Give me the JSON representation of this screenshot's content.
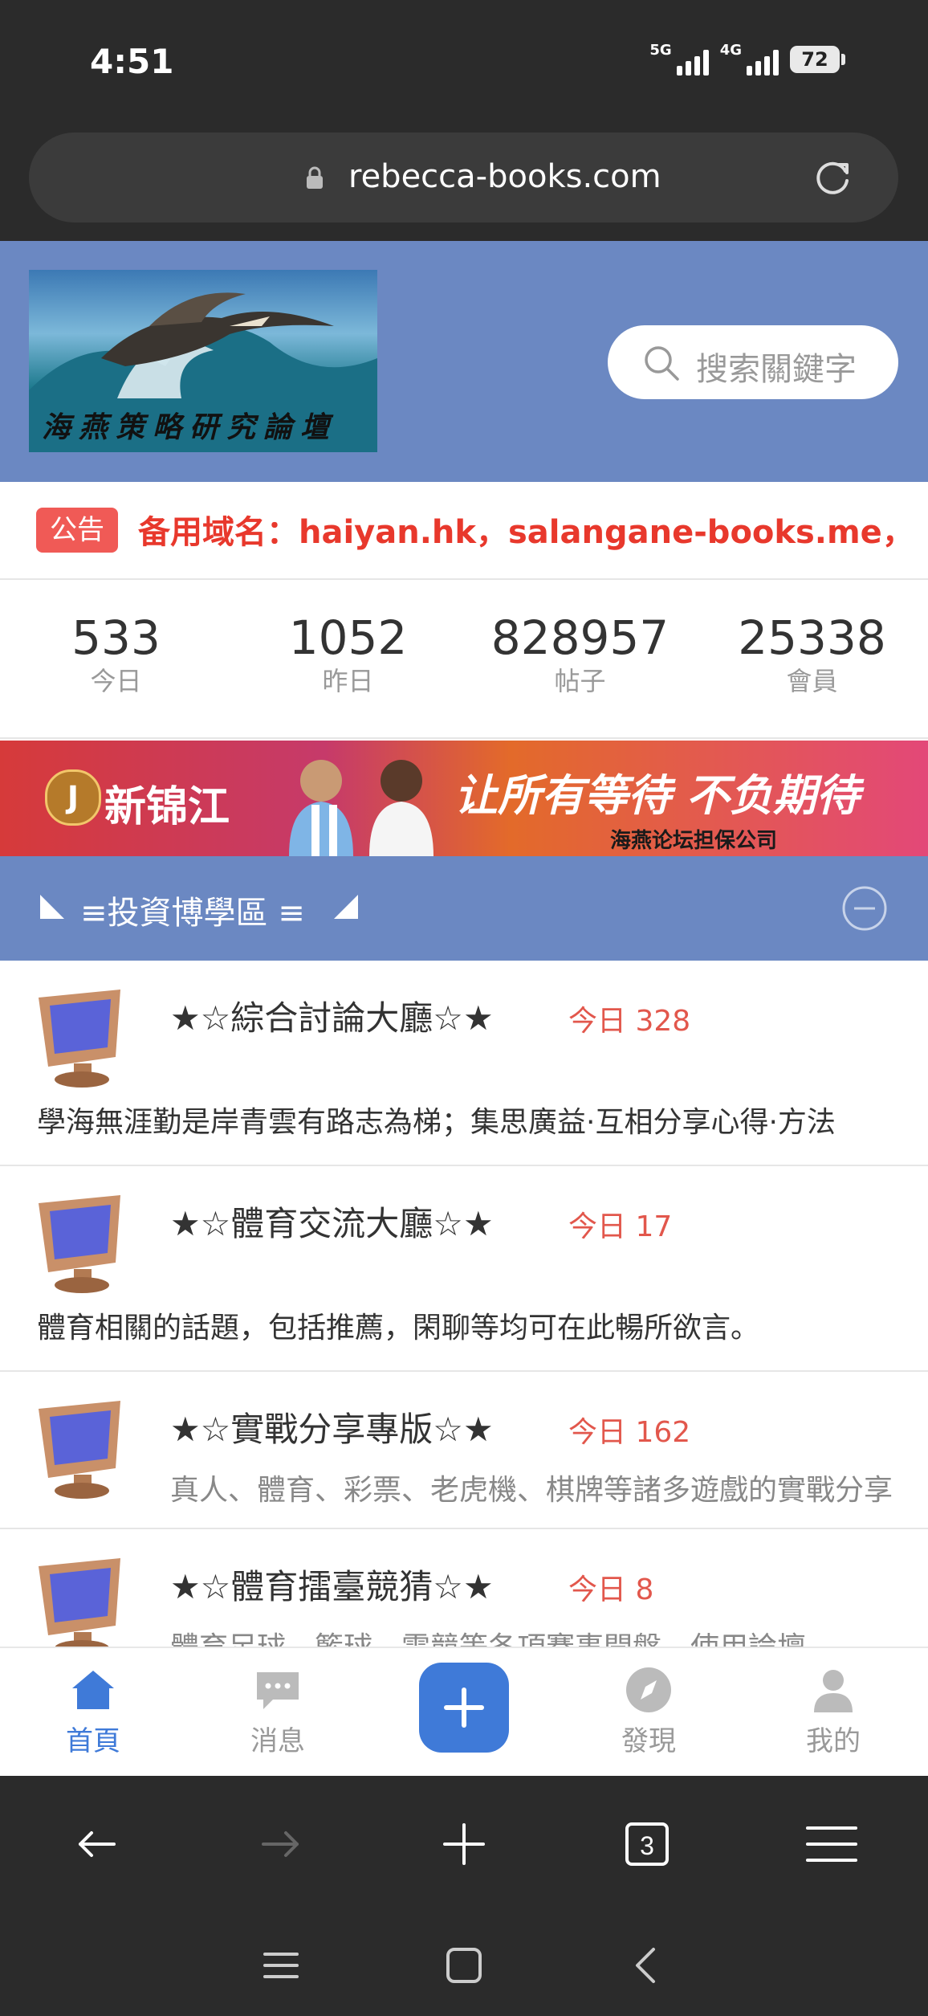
{
  "status": {
    "time": "4:51",
    "net1": "5G",
    "net2": "4G",
    "battery": "72"
  },
  "browser": {
    "url": "rebecca-books.com",
    "tab_count": "3"
  },
  "header": {
    "logo_text": "海燕策略研究論壇",
    "search_placeholder": "搜索關鍵字"
  },
  "notice": {
    "tag": "公告",
    "text": "备用域名：haiyan.hk，salangane-books.me，"
  },
  "stats": [
    {
      "value": "533",
      "label": "今日"
    },
    {
      "value": "1052",
      "label": "昨日"
    },
    {
      "value": "828957",
      "label": "帖子"
    },
    {
      "value": "25338",
      "label": "會員"
    }
  ],
  "banner": {
    "logo_letter": "J",
    "brand": "新锦江",
    "slogan": "让所有等待 不负期待",
    "sub": "海燕论坛担保公司"
  },
  "section": {
    "title": "≡投資博學區 ≡"
  },
  "forums": [
    {
      "name": "★☆綜合討論大廳☆★",
      "today": "今日 328",
      "desc": "學海無涯勤是岸青雲有路志為梯；集思廣益·互相分享心得·方法"
    },
    {
      "name": "★☆體育交流大廳☆★",
      "today": "今日 17",
      "desc": "體育相關的話題，包括推薦，閑聊等均可在此暢所欲言。"
    },
    {
      "name": "★☆實戰分享專版☆★",
      "today": "今日 162",
      "desc": "真人、體育、彩票、老虎機、棋牌等諸多遊戲的實戰分享"
    },
    {
      "name": "★☆體育擂臺競猜☆★",
      "today": "今日 8",
      "desc": "體育足球、籃球、電競等各項賽事開盤，使用論壇"
    }
  ],
  "tabbar": {
    "home": "首頁",
    "messages": "消息",
    "discover": "發現",
    "mine": "我的"
  },
  "colors": {
    "header_blue": "#6b88c2",
    "accent_red": "#e2574c",
    "tab_active": "#3f7ad8"
  }
}
